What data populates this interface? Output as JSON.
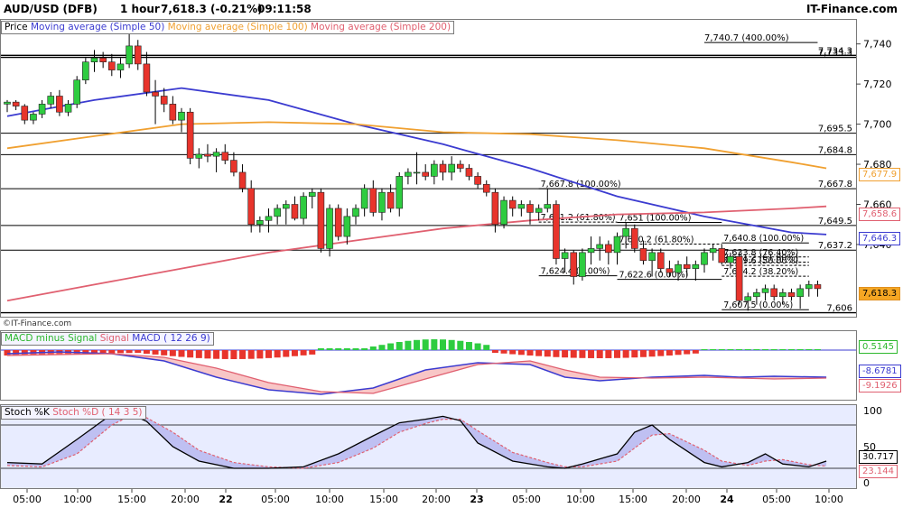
{
  "header": {
    "symbol": "AUD/USD (DFB)",
    "interval": "1 hour",
    "quote": "7,618.3 (-0.21%)",
    "time": "09:11:58",
    "brand": "IT-Finance.com"
  },
  "price_panel": {
    "legend": [
      {
        "label": "Price",
        "color": "#000000"
      },
      {
        "label": "Moving average (Simple 50)",
        "color": "#3b3bd0"
      },
      {
        "label": "Moving average (Simple 100)",
        "color": "#f0a030"
      },
      {
        "label": "Moving average (Simple 200)",
        "color": "#e06070"
      }
    ],
    "copyright": "©IT-Finance.com",
    "y_ticks": [
      "7,740",
      "7,720",
      "7,700",
      "7,680",
      "7,660",
      "7,640"
    ],
    "hlines": [
      {
        "label": "7,734.3"
      },
      {
        "label": "7,733.3"
      },
      {
        "label": "7,695.5"
      },
      {
        "label": "7,684.8"
      },
      {
        "label": "7,667.8"
      },
      {
        "label": "7,649.5"
      },
      {
        "label": "7,637.2"
      },
      {
        "label": "7,606"
      }
    ],
    "fib_labels": [
      "7,740.7 (400.00%)",
      "7,667.8 (100.00%)",
      "7,651.2 (61.80%)",
      "7,624.4 (0.00%)",
      "7,651 (100.00%)",
      "7,640.2 (61.80%)",
      "7,622.6 (0.00%)",
      "7,640.8 (100.00%)",
      "7,633.8 (76.40%)",
      "7,631.2 (61.80%)",
      "7,629.6 (50.00%)",
      "7,624.2 (38.20%)",
      "7,607.5 (0.00%)"
    ],
    "price_boxes": [
      {
        "value": "7,677.9",
        "color": "#f0a030"
      },
      {
        "value": "7,658.6",
        "color": "#e06070"
      },
      {
        "value": "7,646.3",
        "color": "#3b3bd0"
      },
      {
        "value": "7,618.3",
        "color": "#f0a030",
        "filled": true
      }
    ]
  },
  "macd_panel": {
    "legend": [
      {
        "label": "MACD minus Signal",
        "color": "#2db82d"
      },
      {
        "label": "Signal",
        "color": "#e06070"
      },
      {
        "label": "MACD ( 12 26 9)",
        "color": "#3b3bd0"
      }
    ],
    "values": [
      {
        "value": "0.5145",
        "color": "#2db82d"
      },
      {
        "value": "-8.6781",
        "color": "#3b3bd0"
      },
      {
        "value": "-9.1926",
        "color": "#e06070"
      }
    ]
  },
  "stoch_panel": {
    "legend": [
      {
        "label": "Stoch %K",
        "color": "#000000"
      },
      {
        "label": "Stoch %D ( 14 3 5)",
        "color": "#e06070"
      }
    ],
    "y_ticks": [
      "100",
      "50",
      "0"
    ],
    "values": [
      {
        "value": "30.717",
        "color": "#000000"
      },
      {
        "value": "23.144",
        "color": "#e06070"
      }
    ]
  },
  "x_axis": {
    "labels": [
      "05:00",
      "10:00",
      "15:00",
      "20:00",
      "22",
      "05:00",
      "10:00",
      "15:00",
      "20:00",
      "23",
      "05:00",
      "10:00",
      "15:00",
      "20:00",
      "24",
      "05:00",
      "10:00"
    ]
  },
  "chart_data": {
    "type": "candlestick",
    "instrument": "AUD/USD (DFB)",
    "interval": "1 hour",
    "candles": [
      [
        7710,
        7712,
        7706,
        7711
      ],
      [
        7711,
        7712,
        7707,
        7709
      ],
      [
        7709,
        7710,
        7700,
        7702
      ],
      [
        7702,
        7706,
        7700,
        7705
      ],
      [
        7705,
        7712,
        7703,
        7710
      ],
      [
        7710,
        7716,
        7708,
        7714
      ],
      [
        7714,
        7717,
        7704,
        7706
      ],
      [
        7706,
        7712,
        7704,
        7710
      ],
      [
        7710,
        7724,
        7708,
        7722
      ],
      [
        7722,
        7733,
        7720,
        7731
      ],
      [
        7731,
        7737,
        7726,
        7733
      ],
      [
        7733,
        7736,
        7728,
        7731
      ],
      [
        7731,
        7735,
        7724,
        7727
      ],
      [
        7727,
        7733,
        7723,
        7730
      ],
      [
        7730,
        7745,
        7728,
        7739
      ],
      [
        7739,
        7742,
        7727,
        7730
      ],
      [
        7730,
        7736,
        7714,
        7716
      ],
      [
        7716,
        7722,
        7700,
        7714
      ],
      [
        7714,
        7718,
        7706,
        7710
      ],
      [
        7710,
        7714,
        7700,
        7702
      ],
      [
        7702,
        7708,
        7696,
        7706
      ],
      [
        7706,
        7708,
        7680,
        7683
      ],
      [
        7683,
        7688,
        7678,
        7685
      ],
      [
        7685,
        7690,
        7681,
        7684
      ],
      [
        7684,
        7688,
        7676,
        7686
      ],
      [
        7686,
        7690,
        7680,
        7682
      ],
      [
        7682,
        7686,
        7674,
        7676
      ],
      [
        7676,
        7680,
        7666,
        7668
      ],
      [
        7668,
        7672,
        7646,
        7650
      ],
      [
        7650,
        7654,
        7646,
        7652
      ],
      [
        7652,
        7658,
        7646,
        7654
      ],
      [
        7654,
        7660,
        7650,
        7658
      ],
      [
        7658,
        7662,
        7650,
        7660
      ],
      [
        7660,
        7664,
        7652,
        7653
      ],
      [
        7653,
        7666,
        7650,
        7664
      ],
      [
        7664,
        7668,
        7658,
        7666
      ],
      [
        7666,
        7668,
        7636,
        7638
      ],
      [
        7638,
        7660,
        7634,
        7658
      ],
      [
        7658,
        7660,
        7642,
        7644
      ],
      [
        7644,
        7658,
        7640,
        7654
      ],
      [
        7654,
        7660,
        7650,
        7658
      ],
      [
        7658,
        7670,
        7654,
        7668
      ],
      [
        7668,
        7672,
        7654,
        7656
      ],
      [
        7656,
        7668,
        7652,
        7666
      ],
      [
        7666,
        7670,
        7656,
        7658
      ],
      [
        7658,
        7676,
        7654,
        7674
      ],
      [
        7674,
        7678,
        7670,
        7676
      ],
      [
        7676,
        7686,
        7670,
        7676
      ],
      [
        7676,
        7680,
        7672,
        7674
      ],
      [
        7674,
        7682,
        7670,
        7680
      ],
      [
        7680,
        7682,
        7672,
        7676
      ],
      [
        7676,
        7684,
        7672,
        7680
      ],
      [
        7680,
        7682,
        7676,
        7678
      ],
      [
        7678,
        7680,
        7672,
        7674
      ],
      [
        7674,
        7676,
        7668,
        7670
      ],
      [
        7670,
        7672,
        7664,
        7666
      ],
      [
        7666,
        7668,
        7646,
        7650
      ],
      [
        7650,
        7664,
        7648,
        7662
      ],
      [
        7662,
        7664,
        7654,
        7658
      ],
      [
        7658,
        7662,
        7654,
        7660
      ],
      [
        7660,
        7662,
        7650,
        7656
      ],
      [
        7656,
        7660,
        7652,
        7658
      ],
      [
        7658,
        7668,
        7656,
        7660
      ],
      [
        7660,
        7662,
        7630,
        7633
      ],
      [
        7633,
        7638,
        7626,
        7636
      ],
      [
        7636,
        7637,
        7620,
        7624
      ],
      [
        7624,
        7638,
        7622,
        7636
      ],
      [
        7636,
        7644,
        7630,
        7638
      ],
      [
        7638,
        7644,
        7632,
        7640
      ],
      [
        7640,
        7642,
        7630,
        7636
      ],
      [
        7636,
        7646,
        7630,
        7644
      ],
      [
        7644,
        7651,
        7638,
        7648
      ],
      [
        7648,
        7650,
        7636,
        7638
      ],
      [
        7638,
        7642,
        7630,
        7632
      ],
      [
        7632,
        7638,
        7624,
        7636
      ],
      [
        7636,
        7638,
        7626,
        7628
      ],
      [
        7628,
        7632,
        7624,
        7626
      ],
      [
        7626,
        7632,
        7622,
        7630
      ],
      [
        7630,
        7634,
        7624,
        7628
      ],
      [
        7628,
        7632,
        7622,
        7630
      ],
      [
        7630,
        7638,
        7626,
        7636
      ],
      [
        7636,
        7640,
        7632,
        7638
      ],
      [
        7638,
        7640,
        7630,
        7631
      ],
      [
        7631,
        7636,
        7628,
        7634
      ],
      [
        7634,
        7636,
        7610,
        7612
      ],
      [
        7612,
        7616,
        7607,
        7614
      ],
      [
        7614,
        7618,
        7610,
        7616
      ],
      [
        7616,
        7620,
        7612,
        7618
      ],
      [
        7618,
        7620,
        7612,
        7614
      ],
      [
        7614,
        7618,
        7610,
        7616
      ],
      [
        7616,
        7618,
        7612,
        7614
      ],
      [
        7614,
        7620,
        7608,
        7618
      ],
      [
        7618,
        7622,
        7614,
        7620
      ],
      [
        7620,
        7622,
        7614,
        7618
      ]
    ],
    "ma50": [
      [
        0,
        7704
      ],
      [
        10,
        7712
      ],
      [
        20,
        7718
      ],
      [
        30,
        7712
      ],
      [
        40,
        7700
      ],
      [
        50,
        7690
      ],
      [
        60,
        7678
      ],
      [
        70,
        7664
      ],
      [
        80,
        7654
      ],
      [
        90,
        7646
      ],
      [
        94,
        7645
      ]
    ],
    "ma100": [
      [
        0,
        7688
      ],
      [
        10,
        7694
      ],
      [
        20,
        7700
      ],
      [
        30,
        7701
      ],
      [
        40,
        7700
      ],
      [
        50,
        7696
      ],
      [
        60,
        7695
      ],
      [
        70,
        7692
      ],
      [
        80,
        7688
      ],
      [
        90,
        7681
      ],
      [
        94,
        7678
      ]
    ],
    "ma200": [
      [
        0,
        7612
      ],
      [
        10,
        7620
      ],
      [
        20,
        7628
      ],
      [
        30,
        7636
      ],
      [
        40,
        7642
      ],
      [
        50,
        7648
      ],
      [
        60,
        7652
      ],
      [
        70,
        7655
      ],
      [
        80,
        7656
      ],
      [
        90,
        7658
      ],
      [
        94,
        7659
      ]
    ],
    "y_range": [
      7604,
      7752
    ],
    "stoch_k": [
      [
        0,
        28
      ],
      [
        4,
        26
      ],
      [
        8,
        60
      ],
      [
        12,
        95
      ],
      [
        14,
        96
      ],
      [
        16,
        85
      ],
      [
        19,
        50
      ],
      [
        22,
        30
      ],
      [
        26,
        20
      ],
      [
        30,
        20
      ],
      [
        34,
        22
      ],
      [
        38,
        40
      ],
      [
        42,
        65
      ],
      [
        45,
        83
      ],
      [
        48,
        88
      ],
      [
        50,
        92
      ],
      [
        52,
        86
      ],
      [
        54,
        55
      ],
      [
        58,
        30
      ],
      [
        62,
        22
      ],
      [
        64,
        20
      ],
      [
        66,
        26
      ],
      [
        70,
        40
      ],
      [
        72,
        70
      ],
      [
        74,
        80
      ],
      [
        76,
        60
      ],
      [
        80,
        28
      ],
      [
        82,
        22
      ],
      [
        85,
        28
      ],
      [
        87,
        40
      ],
      [
        89,
        26
      ],
      [
        92,
        22
      ],
      [
        94,
        30
      ]
    ],
    "stoch_d": [
      [
        0,
        24
      ],
      [
        4,
        22
      ],
      [
        8,
        40
      ],
      [
        12,
        80
      ],
      [
        14,
        92
      ],
      [
        16,
        90
      ],
      [
        19,
        70
      ],
      [
        22,
        45
      ],
      [
        26,
        28
      ],
      [
        30,
        22
      ],
      [
        34,
        20
      ],
      [
        38,
        28
      ],
      [
        42,
        48
      ],
      [
        45,
        70
      ],
      [
        48,
        82
      ],
      [
        50,
        88
      ],
      [
        52,
        88
      ],
      [
        54,
        72
      ],
      [
        58,
        42
      ],
      [
        62,
        28
      ],
      [
        64,
        22
      ],
      [
        66,
        22
      ],
      [
        70,
        30
      ],
      [
        72,
        48
      ],
      [
        74,
        66
      ],
      [
        76,
        68
      ],
      [
        80,
        45
      ],
      [
        82,
        30
      ],
      [
        85,
        24
      ],
      [
        87,
        30
      ],
      [
        89,
        32
      ],
      [
        92,
        25
      ],
      [
        94,
        23
      ]
    ]
  }
}
